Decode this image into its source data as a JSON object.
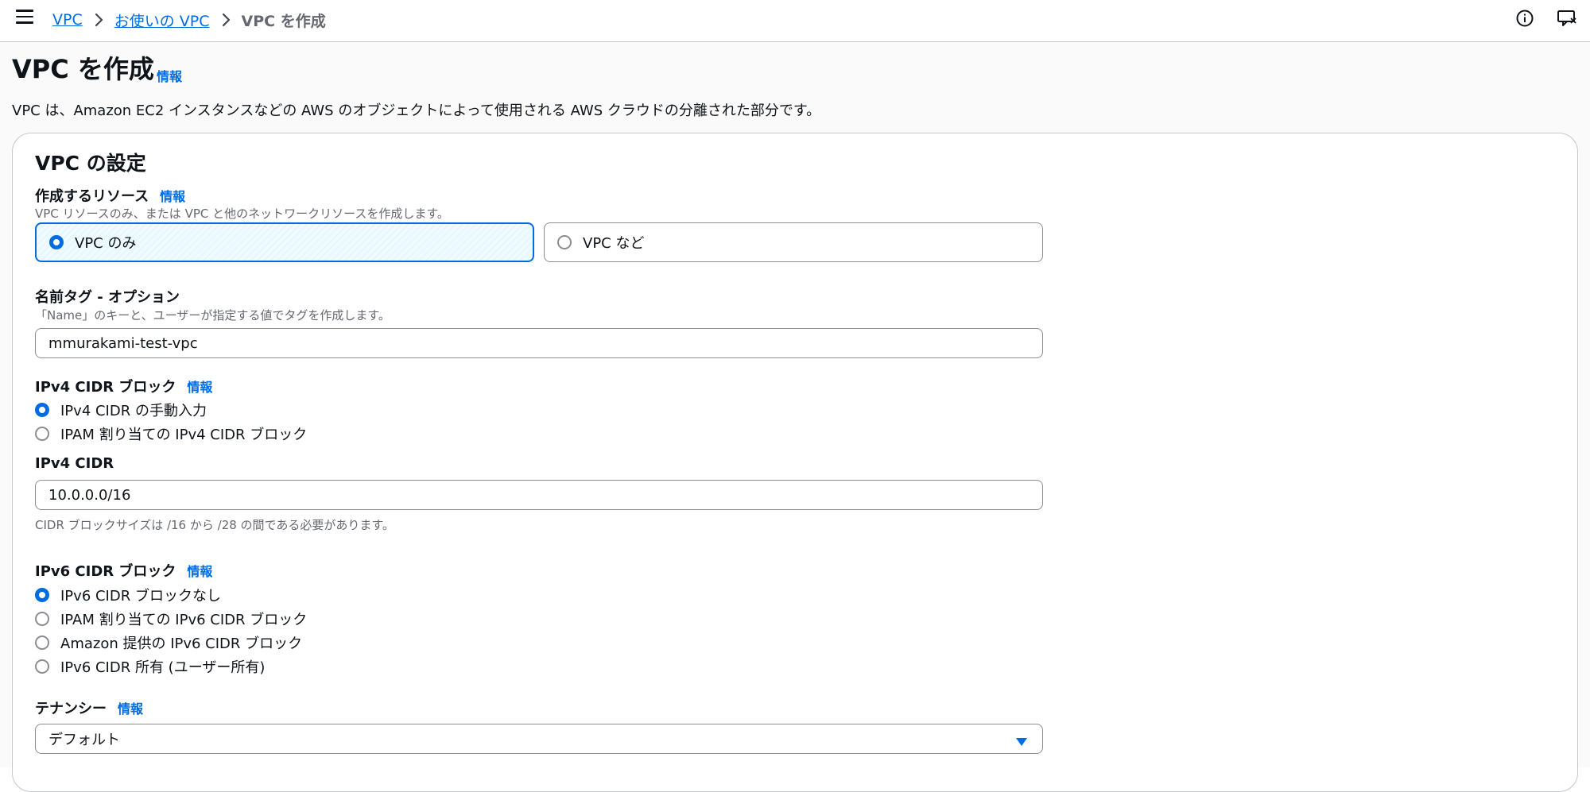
{
  "breadcrumb": {
    "items": [
      "VPC",
      "お使いの VPC"
    ],
    "current": "VPC を作成"
  },
  "page": {
    "title": "VPC を作成",
    "info": "情報",
    "description": "VPC は、Amazon EC2 インスタンスなどの AWS のオブジェクトによって使用される AWS クラウドの分離された部分です。"
  },
  "settings": {
    "title": "VPC の設定",
    "resources": {
      "label": "作成するリソース",
      "info": "情報",
      "hint": "VPC リソースのみ、または VPC と他のネットワークリソースを作成します。",
      "options": [
        "VPC のみ",
        "VPC など"
      ],
      "selected": "VPC のみ"
    },
    "name_tag": {
      "label": "名前タグ - オプション",
      "hint": "「Name」のキーと、ユーザーが指定する値でタグを作成します。",
      "value": "mmurakami-test-vpc"
    },
    "ipv4_block": {
      "label": "IPv4 CIDR ブロック",
      "info": "情報",
      "options": [
        "IPv4 CIDR の手動入力",
        "IPAM 割り当ての IPv4 CIDR ブロック"
      ],
      "selected": "IPv4 CIDR の手動入力"
    },
    "ipv4_cidr": {
      "label": "IPv4 CIDR",
      "value": "10.0.0.0/16",
      "hint": "CIDR ブロックサイズは /16 から /28 の間である必要があります。"
    },
    "ipv6_block": {
      "label": "IPv6 CIDR ブロック",
      "info": "情報",
      "options": [
        "IPv6 CIDR ブロックなし",
        "IPAM 割り当ての IPv6 CIDR ブロック",
        "Amazon 提供の IPv6 CIDR ブロック",
        "IPv6 CIDR 所有 (ユーザー所有)"
      ],
      "selected": "IPv6 CIDR ブロックなし"
    },
    "tenancy": {
      "label": "テナンシー",
      "info": "情報",
      "value": "デフォルト"
    }
  },
  "colors": {
    "accent": "#006ce0",
    "text": "#0f141a",
    "muted": "#656871",
    "border": "#8c8c94"
  },
  "icons": {
    "menu": "hamburger-menu-icon",
    "chevron": "chevron-right-icon",
    "info": "info-circle-icon",
    "feedback": "feedback-icon",
    "caret": "caret-down-icon"
  }
}
